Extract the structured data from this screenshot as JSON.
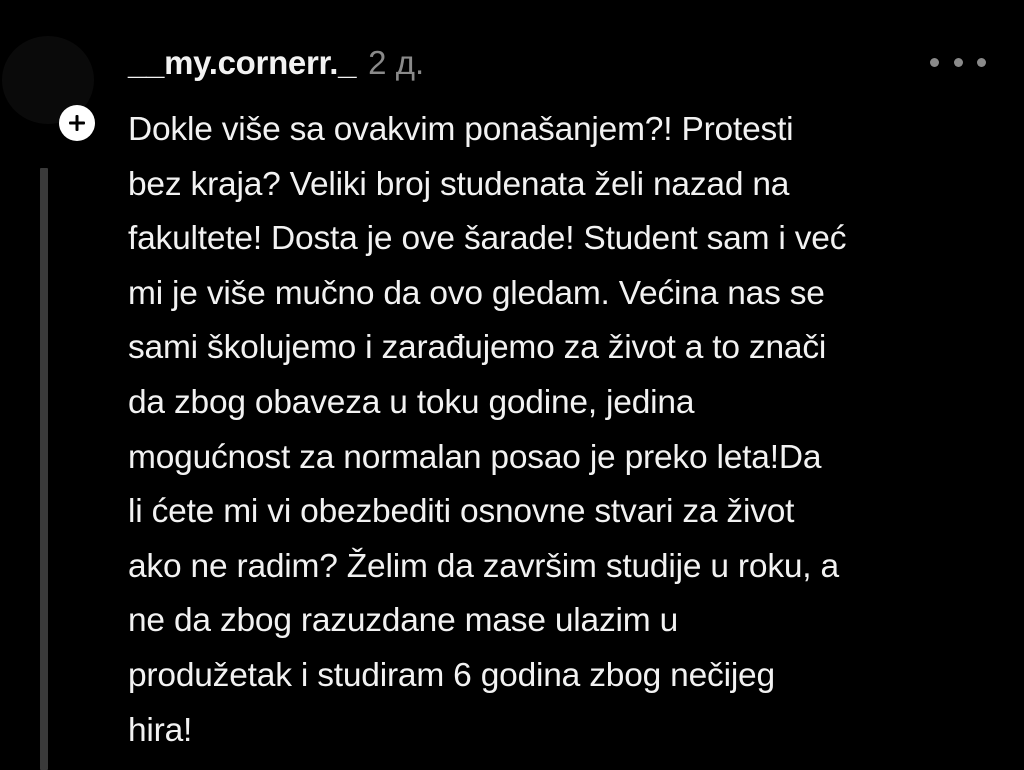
{
  "comment": {
    "username": "__my.cornerr._",
    "timestamp": "2 д.",
    "more_icon": "more-horizontal-icon",
    "expand_icon": "plus-circle-icon",
    "body_lines": [
      "Dokle više sa ovakvim ponašanjem?! Protesti",
      "bez kraja? Veliki broj studenata želi nazad na",
      "fakultete! Dosta je ove šarade! Student sam i već",
      "mi je više mučno da ovo gledam. Većina nas se",
      "sami školujemo i zarađujemo za život a to znači",
      "da zbog obaveza u toku godine, jedina",
      "mogućnost za normalan posao je preko leta!Da",
      "li ćete mi vi obezbediti osnovne stvari za život",
      "ako ne radim? Želim da završim studije u roku, a",
      "ne da zbog razuzdane mase ulazim u",
      "produžetak i studiram 6 godina zbog nečijeg",
      "hira!"
    ]
  },
  "colors": {
    "background": "#000000",
    "text": "#f2f2f2",
    "muted": "#8a8a8a",
    "thread_line": "#3a3a3a"
  }
}
